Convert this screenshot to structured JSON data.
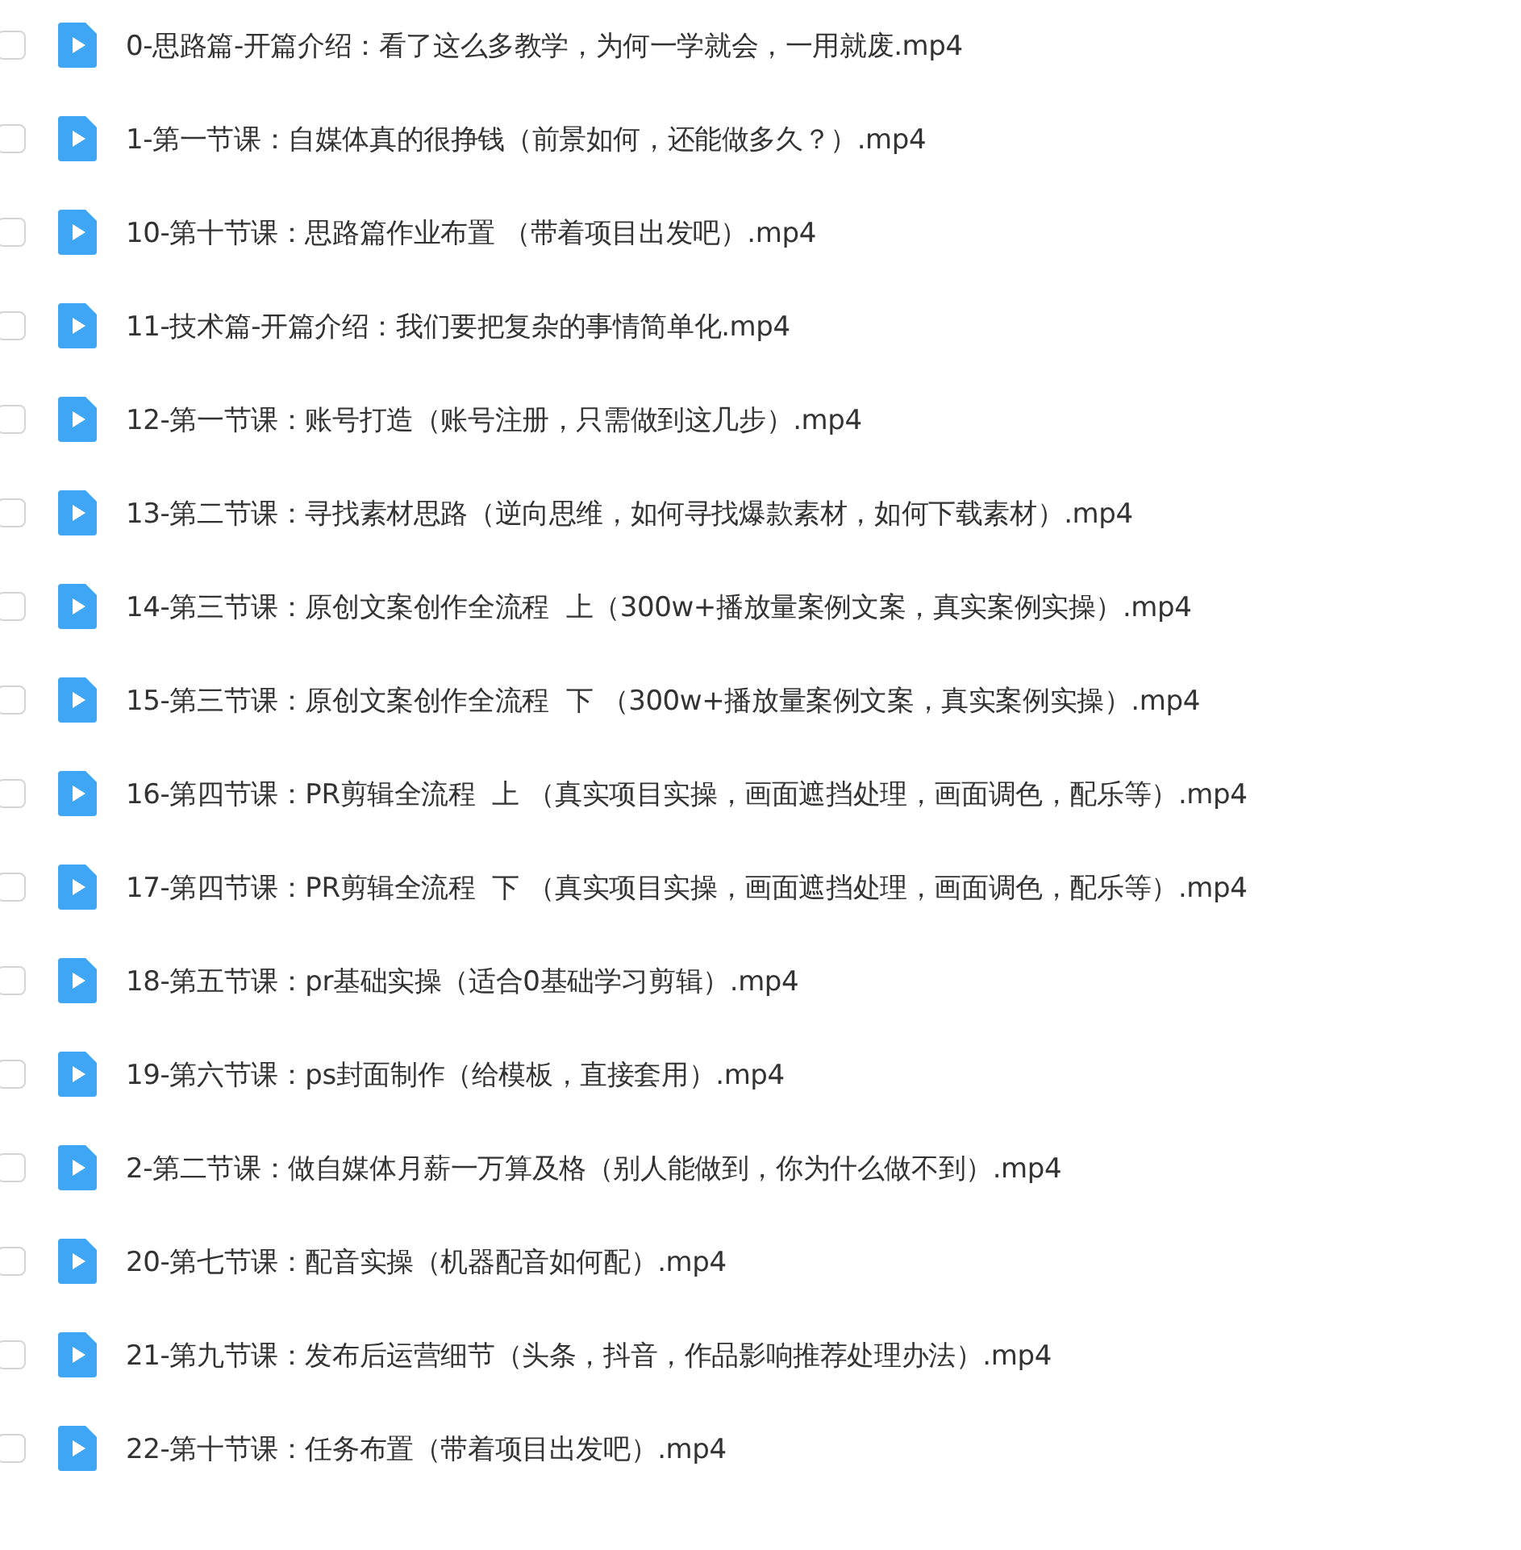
{
  "files": [
    {
      "name": "0-思路篇-开篇介绍：看了这么多教学，为何一学就会，一用就废.mp4",
      "checked": false
    },
    {
      "name": "1-第一节课：自媒体真的很挣钱（前景如何，还能做多久？）.mp4",
      "checked": false
    },
    {
      "name": "10-第十节课：思路篇作业布置 （带着项目出发吧）.mp4",
      "checked": false
    },
    {
      "name": "11-技术篇-开篇介绍：我们要把复杂的事情简单化.mp4",
      "checked": false
    },
    {
      "name": "12-第一节课：账号打造（账号注册，只需做到这几步）.mp4",
      "checked": false
    },
    {
      "name": "13-第二节课：寻找素材思路（逆向思维，如何寻找爆款素材，如何下载素材）.mp4",
      "checked": false
    },
    {
      "name": "14-第三节课：原创文案创作全流程  上（300w+播放量案例文案，真实案例实操）.mp4",
      "checked": false
    },
    {
      "name": "15-第三节课：原创文案创作全流程  下 （300w+播放量案例文案，真实案例实操）.mp4",
      "checked": false
    },
    {
      "name": "16-第四节课：PR剪辑全流程  上 （真实项目实操，画面遮挡处理，画面调色，配乐等）.mp4",
      "checked": false
    },
    {
      "name": "17-第四节课：PR剪辑全流程  下 （真实项目实操，画面遮挡处理，画面调色，配乐等）.mp4",
      "checked": false
    },
    {
      "name": "18-第五节课：pr基础实操（适合0基础学习剪辑）.mp4",
      "checked": false
    },
    {
      "name": "19-第六节课：ps封面制作（给模板，直接套用）.mp4",
      "checked": false
    },
    {
      "name": "2-第二节课：做自媒体月薪一万算及格（别人能做到，你为什么做不到）.mp4",
      "checked": false
    },
    {
      "name": "20-第七节课：配音实操（机器配音如何配）.mp4",
      "checked": false
    },
    {
      "name": "21-第九节课：发布后运营细节（头条，抖音，作品影响推荐处理办法）.mp4",
      "checked": false
    },
    {
      "name": "22-第十节课：任务布置（带着项目出发吧）.mp4",
      "checked": false
    }
  ]
}
